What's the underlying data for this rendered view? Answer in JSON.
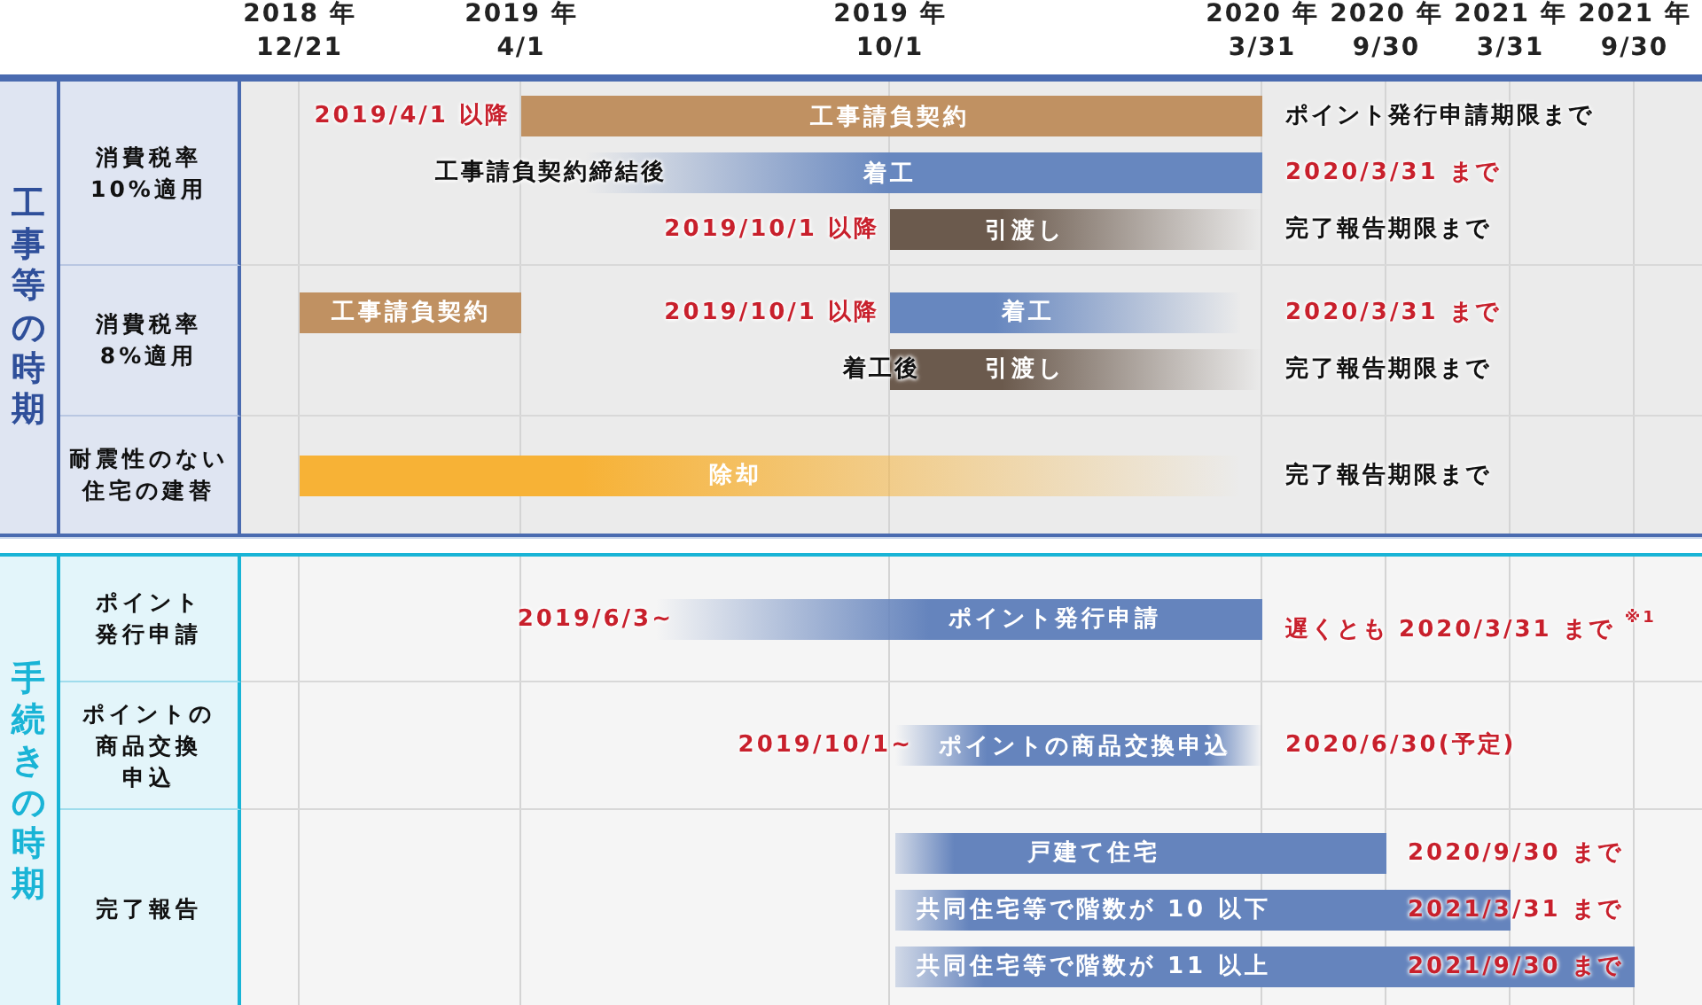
{
  "axis": {
    "ticks": [
      {
        "year": "2018 年",
        "date": "12/21"
      },
      {
        "year": "2019 年",
        "date": "4/1"
      },
      {
        "year": "2019 年",
        "date": "10/1"
      },
      {
        "year": "2020 年",
        "date": "3/31"
      },
      {
        "year": "2020 年",
        "date": "9/30"
      },
      {
        "year": "2021 年",
        "date": "3/31"
      },
      {
        "year": "2021 年",
        "date": "9/30"
      }
    ]
  },
  "sections": [
    {
      "kind": "works",
      "title": "工事等の時期",
      "rows": [
        {
          "label": [
            "消費税率",
            "10%適用"
          ],
          "lines": [
            {
              "before": {
                "text": "2019/4/1 以降",
                "kind": "date"
              },
              "bars": [
                {
                  "kind": "contract",
                  "label": "工事請負契約"
                }
              ],
              "after": {
                "text": "ポイント発行申請期限まで",
                "kind": "plain"
              }
            },
            {
              "before": {
                "text": "工事請負契約締結後",
                "kind": "plain"
              },
              "bars": [
                {
                  "kind": "construction",
                  "label": "着工"
                }
              ],
              "after": {
                "text": "2020/3/31 まで",
                "kind": "date"
              }
            },
            {
              "before": {
                "text": "2019/10/1 以降",
                "kind": "date"
              },
              "bars": [
                {
                  "kind": "handover",
                  "label": "引渡し"
                }
              ],
              "after": {
                "text": "完了報告期限まで",
                "kind": "plain"
              }
            }
          ]
        },
        {
          "label": [
            "消費税率",
            "8%適用"
          ],
          "lines": [
            {
              "before": {
                "text": "2019/10/1 以降",
                "kind": "date"
              },
              "bars": [
                {
                  "kind": "contract",
                  "label": "工事請負契約"
                },
                {
                  "kind": "construction",
                  "label": "着工"
                }
              ],
              "after": {
                "text": "2020/3/31 まで",
                "kind": "date"
              }
            },
            {
              "before": {
                "text": "着工後",
                "kind": "plain"
              },
              "bars": [
                {
                  "kind": "handover",
                  "label": "引渡し"
                }
              ],
              "after": {
                "text": "完了報告期限まで",
                "kind": "plain"
              }
            }
          ]
        },
        {
          "label": [
            "耐震性のない",
            "住宅の建替"
          ],
          "lines": [
            {
              "bars": [
                {
                  "kind": "demolition",
                  "label": "除却"
                }
              ],
              "after": {
                "text": "完了報告期限まで",
                "kind": "plain"
              }
            }
          ]
        }
      ]
    },
    {
      "kind": "procedures",
      "title": "手続きの時期",
      "rows": [
        {
          "label": [
            "ポイント",
            "発行申請"
          ],
          "lines": [
            {
              "before": {
                "text": "2019/6/3~",
                "kind": "date"
              },
              "bars": [
                {
                  "kind": "procedure",
                  "label": "ポイント発行申請"
                }
              ],
              "after": {
                "text": "遅くとも 2020/3/31 まで$^{※1}$",
                "kind": "date"
              }
            }
          ]
        },
        {
          "label": [
            "ポイントの",
            "商品交換",
            "申込"
          ],
          "lines": [
            {
              "before": {
                "text": "2019/10/1~",
                "kind": "date"
              },
              "bars": [
                {
                  "kind": "procedure",
                  "label": "ポイントの商品交換申込"
                }
              ],
              "after": {
                "text": "2020/6/30(予定)",
                "kind": "date"
              }
            }
          ]
        },
        {
          "label": [
            "完了報告"
          ],
          "lines": [
            {
              "bars": [
                {
                  "kind": "procedure",
                  "label": "戸建て住宅"
                }
              ],
              "after": {
                "text": "2020/9/30 まで",
                "kind": "date"
              }
            },
            {
              "bars": [
                {
                  "kind": "procedure",
                  "label": "共同住宅等で階数が 10 以下"
                }
              ],
              "after": {
                "text": "2021/3/31 まで",
                "kind": "date"
              }
            },
            {
              "bars": [
                {
                  "kind": "procedure",
                  "label": "共同住宅等で階数が 11 以上"
                }
              ],
              "after": {
                "text": "2021/9/30 まで",
                "kind": "date"
              }
            }
          ]
        }
      ]
    }
  ]
}
